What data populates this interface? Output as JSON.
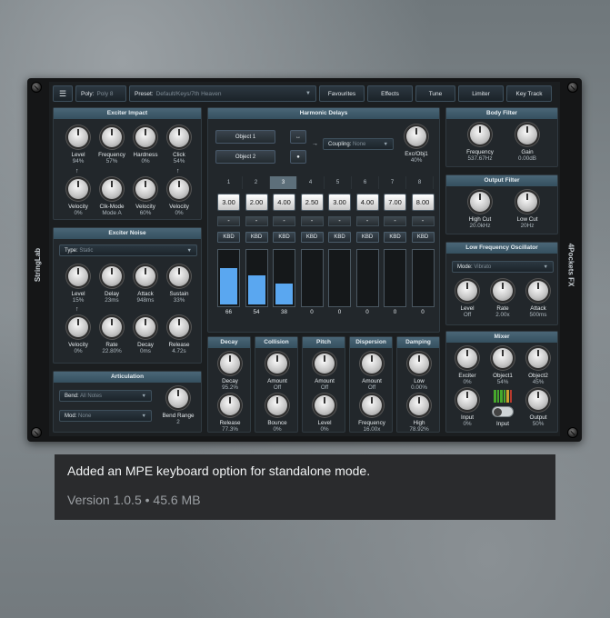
{
  "side_left": "StringLab",
  "side_right": "4Pockets FX",
  "topbar": {
    "poly_label": "Poly:",
    "poly_value": "Poly 8",
    "preset_label": "Preset:",
    "preset_value": "Default/Keys/7th Heaven",
    "favourites": "Favourites",
    "effects": "Effects",
    "tune": "Tune",
    "limiter": "Limiter",
    "key_track": "Key Track"
  },
  "exciter_impact": {
    "title": "Exciter Impact",
    "knobs": [
      {
        "label": "Level",
        "value": "94%"
      },
      {
        "label": "Frequency",
        "value": "57%"
      },
      {
        "label": "Hardness",
        "value": "0%"
      },
      {
        "label": "Click",
        "value": "54%"
      },
      {
        "label": "Velocity",
        "value": "0%"
      },
      {
        "label": "Clk-Mode",
        "value": "Mode A"
      },
      {
        "label": "Velocity",
        "value": "60%"
      },
      {
        "label": "Velocity",
        "value": "0%"
      }
    ]
  },
  "exciter_noise": {
    "title": "Exciter Noise",
    "type_label": "Type:",
    "type_value": "Static",
    "knobs": [
      {
        "label": "Level",
        "value": "15%"
      },
      {
        "label": "Delay",
        "value": "23ms"
      },
      {
        "label": "Attack",
        "value": "948ms"
      },
      {
        "label": "Sustain",
        "value": "33%"
      },
      {
        "label": "Velocity",
        "value": "0%"
      },
      {
        "label": "Rate",
        "value": "22.80%"
      },
      {
        "label": "Decay",
        "value": "0ms"
      },
      {
        "label": "Release",
        "value": "4.72s"
      }
    ]
  },
  "articulation": {
    "title": "Articulation",
    "bend_label": "Bend:",
    "bend_value": "All Notes",
    "mod_label": "Mod:",
    "mod_value": "None",
    "knob": {
      "label": "Bend Range",
      "value": "2"
    }
  },
  "harmonic_delays": {
    "title": "Harmonic Delays",
    "object1": "Object 1",
    "object2": "Object 2",
    "coupling_label": "Coupling:",
    "coupling_value": "None",
    "knob": {
      "label": "Exc/Obj1",
      "value": "40%"
    },
    "tabs": [
      "1",
      "2",
      "3",
      "4",
      "5",
      "6",
      "7",
      "8"
    ],
    "active_tab": 2,
    "ratios": [
      "3.00",
      "2.00",
      "4.00",
      "2.50",
      "3.00",
      "4.00",
      "7.00",
      "8.00"
    ],
    "kbd_label": "KBD",
    "bars": [
      66,
      54,
      38,
      0,
      0,
      0,
      0,
      0
    ]
  },
  "body_filter": {
    "title": "Body Filter",
    "knobs": [
      {
        "label": "Frequency",
        "value": "537.67Hz"
      },
      {
        "label": "Gain",
        "value": "0.00dB"
      }
    ]
  },
  "output_filter": {
    "title": "Output Filter",
    "knobs": [
      {
        "label": "High Cut",
        "value": "20.0kHz"
      },
      {
        "label": "Low Cut",
        "value": "20Hz"
      }
    ]
  },
  "lfo": {
    "title": "Low Frequency Oscillator",
    "mode_label": "Mode:",
    "mode_value": "Vibrato",
    "knobs": [
      {
        "label": "Level",
        "value": "Off"
      },
      {
        "label": "Rate",
        "value": "2.00x"
      },
      {
        "label": "Attack",
        "value": "500ms"
      }
    ]
  },
  "decay": {
    "title": "Decay",
    "knobs": [
      {
        "label": "Decay",
        "value": "95.2%"
      },
      {
        "label": "Release",
        "value": "77.3%"
      }
    ]
  },
  "collision": {
    "title": "Collision",
    "knobs": [
      {
        "label": "Amount",
        "value": "Off"
      },
      {
        "label": "Bounce",
        "value": "0%"
      }
    ]
  },
  "pitch": {
    "title": "Pitch",
    "knobs": [
      {
        "label": "Amount",
        "value": "Off"
      },
      {
        "label": "Level",
        "value": "0%"
      }
    ]
  },
  "dispersion": {
    "title": "Dispersion",
    "knobs": [
      {
        "label": "Amount",
        "value": "Off"
      },
      {
        "label": "Frequency",
        "value": "16.00x"
      }
    ]
  },
  "damping": {
    "title": "Damping",
    "knobs": [
      {
        "label": "Low",
        "value": "0.00%"
      },
      {
        "label": "High",
        "value": "78.92%"
      }
    ]
  },
  "mixer": {
    "title": "Mixer",
    "knobs": [
      {
        "label": "Exciter",
        "value": "0%"
      },
      {
        "label": "Object1",
        "value": "54%"
      },
      {
        "label": "Object2",
        "value": "45%"
      },
      {
        "label": "Input",
        "value": "0%"
      },
      {
        "label": "Output",
        "value": "50%"
      }
    ],
    "input_label": "Input"
  },
  "caption": {
    "line1": "Added an MPE keyboard option for standalone mode.",
    "line2": "Version 1.0.5 • 45.6 MB"
  }
}
